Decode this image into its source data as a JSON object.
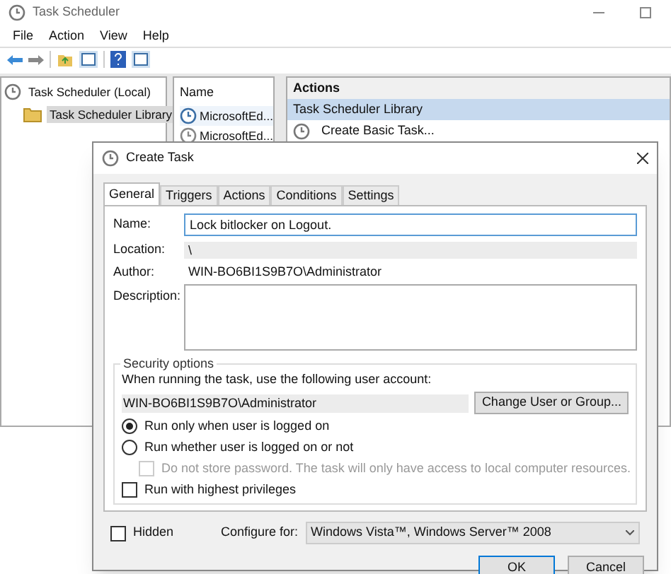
{
  "window": {
    "title": "Task Scheduler"
  },
  "menu": [
    "File",
    "Action",
    "View",
    "Help"
  ],
  "tree": [
    {
      "label": "Task Scheduler (Local)",
      "selected": false,
      "children": [
        {
          "label": "Task Scheduler Library",
          "selected": true
        }
      ]
    }
  ],
  "task_list": {
    "column": "Name",
    "rows": [
      {
        "name": "MicrosoftEd...",
        "selected": true
      },
      {
        "name": "MicrosoftEd...",
        "selected": false
      }
    ]
  },
  "actions_pane": {
    "header": "Actions",
    "section": "Task Scheduler Library",
    "items": [
      "Create Basic Task..."
    ]
  },
  "dialog": {
    "title": "Create Task",
    "tabs": [
      {
        "label": "General",
        "selected": true
      },
      {
        "label": "Triggers",
        "selected": false
      },
      {
        "label": "Actions",
        "selected": false
      },
      {
        "label": "Conditions",
        "selected": false
      },
      {
        "label": "Settings",
        "selected": false
      }
    ],
    "name": {
      "label": "Name:",
      "value": "Lock bitlocker on Logout."
    },
    "location": {
      "label": "Location:",
      "value": "\\"
    },
    "author": {
      "label": "Author:",
      "value": "WIN-BO6BI1S9B7O\\Administrator"
    },
    "description": {
      "label": "Description:"
    },
    "security": {
      "title": "Security options",
      "prompt": "When running the task, use the following user account:",
      "account": "WIN-BO6BI1S9B7O\\Administrator",
      "change_button": "Change User or Group...",
      "options": [
        {
          "kind": "radio",
          "label": "Run only when user is logged on",
          "selected": true
        },
        {
          "kind": "radio",
          "label": "Run whether user is logged on or not",
          "selected": false
        },
        {
          "kind": "checkbox",
          "label": "Do not store password.  The task will only have access to local computer resources.",
          "checked": false,
          "disabled": true
        },
        {
          "kind": "checkbox",
          "label": "Run with highest privileges",
          "checked": false,
          "disabled": false
        }
      ]
    },
    "hidden": {
      "label": "Hidden",
      "checked": false
    },
    "configure": {
      "label": "Configure for:",
      "value": "Windows Vista™, Windows Server™ 2008"
    },
    "buttons": [
      {
        "label": "OK",
        "default": true
      },
      {
        "label": "Cancel",
        "default": false
      }
    ]
  }
}
